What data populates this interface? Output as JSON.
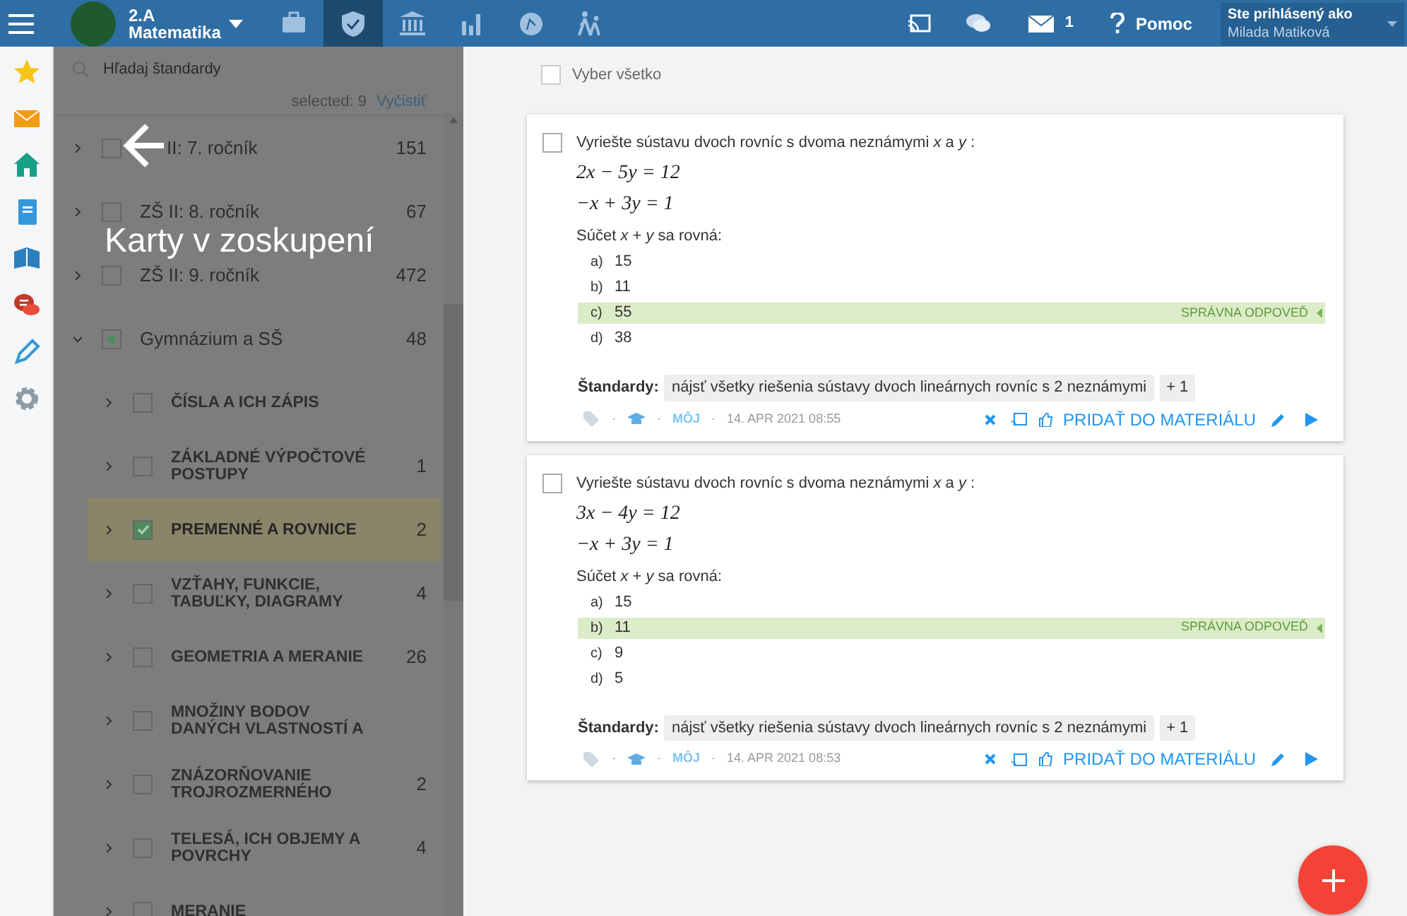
{
  "topbar": {
    "class_name": "2.A",
    "subject": "Matematika",
    "nav_icons": [
      {
        "kind": "briefcase",
        "selected": false
      },
      {
        "kind": "shield",
        "selected": true
      },
      {
        "kind": "bank",
        "selected": false
      },
      {
        "kind": "chart",
        "selected": false
      },
      {
        "kind": "compass",
        "selected": false
      },
      {
        "kind": "walk",
        "selected": false
      }
    ],
    "mail_count": "1",
    "help": "Pomoc",
    "user_caption": "Ste prihlásený ako",
    "user_name": "Milada Matiková"
  },
  "rail": [
    {
      "kind": "star"
    },
    {
      "kind": "mail"
    },
    {
      "kind": "home"
    },
    {
      "kind": "notebook"
    },
    {
      "kind": "book"
    },
    {
      "kind": "chat"
    },
    {
      "kind": "pen"
    },
    {
      "kind": "gear"
    }
  ],
  "standards": {
    "search_placeholder": "Hľadaj štandardy",
    "selected_text": "selected: 9",
    "clear": "Vyčistiť",
    "items": [
      {
        "label": "II: 7. ročník",
        "count": "151",
        "checked": false,
        "partial": false,
        "expanded": false
      },
      {
        "label": "ZŠ II: 8. ročník",
        "count": "67",
        "checked": false,
        "partial": false,
        "expanded": false
      },
      {
        "label": "ZŠ II: 9. ročník",
        "count": "472",
        "checked": false,
        "partial": false,
        "expanded": false
      },
      {
        "label": "Gymnázium a SŠ",
        "count": "48",
        "checked": false,
        "partial": true,
        "expanded": true,
        "children": [
          {
            "label": "ČÍSLA A ICH ZÁPIS",
            "checked": false,
            "selected": false
          },
          {
            "label": "ZÁKLADNÉ VÝPOČTOVÉ POSTUPY",
            "count": "1",
            "checked": false,
            "selected": false
          },
          {
            "label": "PREMENNÉ A ROVNICE",
            "count": "2",
            "checked": true,
            "selected": true
          },
          {
            "label": "VZŤAHY, FUNKCIE, TABUĽKY, DIAGRAMY",
            "count": "4",
            "checked": false,
            "selected": false
          },
          {
            "label": "GEOMETRIA A MERANIE",
            "count": "26",
            "checked": false,
            "selected": false
          },
          {
            "label": "MNOŽINY BODOV DANÝCH VLASTNOSTÍ A",
            "checked": false,
            "selected": false
          },
          {
            "label": "ZNÁZORŇOVANIE TROJROZMERNÉHO",
            "count": "2",
            "checked": false,
            "selected": false
          },
          {
            "label": "TELESÁ, ICH OBJEMY A POVRCHY",
            "count": "4",
            "checked": false,
            "selected": false
          },
          {
            "label": "MERANIE",
            "checked": false,
            "selected": false
          }
        ]
      }
    ]
  },
  "overlay": {
    "title": "Karty v zoskupení"
  },
  "select_all": {
    "label": "Vyber všetko",
    "checked": false
  },
  "cards": [
    {
      "checked": false,
      "question": "Vyriešte sústavu dvoch rovníc s dvoma neznámymi *x* a *y* :",
      "equations": [
        "2x − 5y = 12",
        "−x + 3y = 1"
      ],
      "prompt": "Súčet *x* + *y* sa rovná:",
      "options": [
        {
          "letter": "a)",
          "text": "15",
          "correct": false
        },
        {
          "letter": "b)",
          "text": "11",
          "correct": false
        },
        {
          "letter": "c)",
          "text": "55",
          "correct": true
        },
        {
          "letter": "d)",
          "text": "38",
          "correct": false
        }
      ],
      "correct_label": "SPRÁVNA ODPOVEĎ",
      "standards_label": "Štandardy:",
      "standards": [
        "nájsť všetky riešenia sústavy dvoch lineárnych rovníc s 2 neznámymi",
        "+ 1"
      ],
      "separators": [
        "·",
        "·",
        "·"
      ],
      "owner": "MÔJ",
      "date": "14. APR 2021 08:55",
      "add": "PRIDAŤ DO MATERIÁLU"
    },
    {
      "checked": false,
      "question": "Vyriešte sústavu dvoch rovníc s dvoma neznámymi *x* a *y* :",
      "equations": [
        "3x − 4y = 12",
        "−x + 3y = 1"
      ],
      "prompt": "Súčet *x* + *y* sa rovná:",
      "options": [
        {
          "letter": "a)",
          "text": "15",
          "correct": false
        },
        {
          "letter": "b)",
          "text": "11",
          "correct": true
        },
        {
          "letter": "c)",
          "text": "9",
          "correct": false
        },
        {
          "letter": "d)",
          "text": "5",
          "correct": false
        }
      ],
      "correct_label": "SPRÁVNA ODPOVEĎ",
      "standards_label": "Štandardy:",
      "standards": [
        "nájsť všetky riešenia sústavy dvoch lineárnych rovníc s 2 neznámymi",
        "+ 1"
      ],
      "separators": [
        "·",
        "·",
        "·"
      ],
      "owner": "MÔJ",
      "date": "14. APR 2021 08:53",
      "add": "PRIDAŤ DO MATERIÁLU"
    }
  ]
}
